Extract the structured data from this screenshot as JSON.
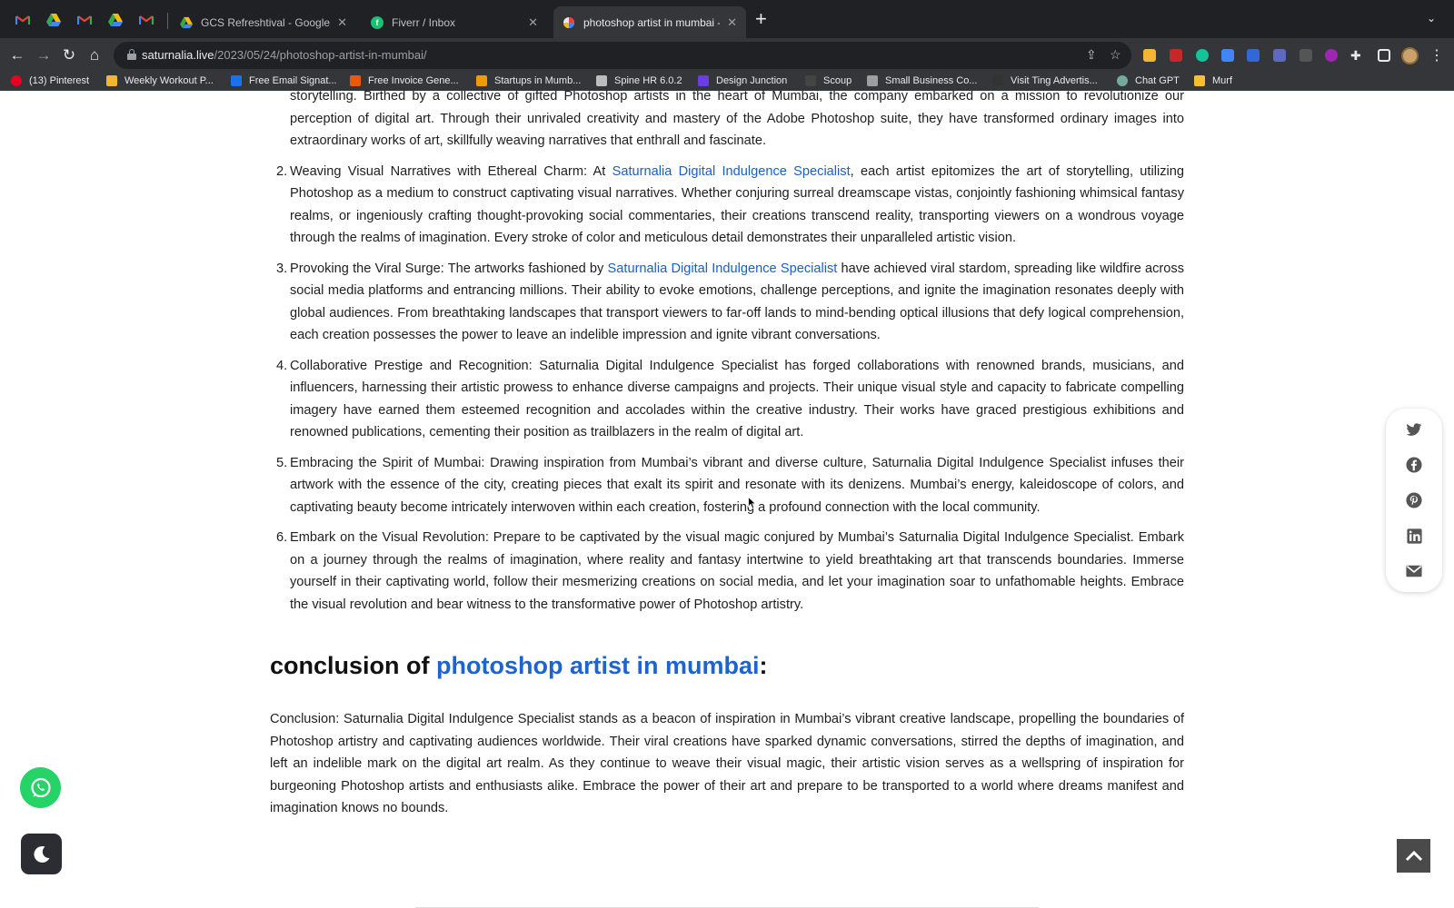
{
  "browser": {
    "tabs": [
      {
        "title": "GCS Refreshtival - Google Drive",
        "favicon": "google-drive"
      },
      {
        "title": "Fiverr / Inbox",
        "favicon": "fiverr"
      },
      {
        "title": "photoshop artist in mumbai - S",
        "favicon": "site",
        "active": true
      }
    ],
    "url_host": "saturnalia.live",
    "url_path": "/2023/05/24/photoshop-artist-in-mumbai/",
    "bookmarks": [
      {
        "label": "(13) Pinterest",
        "icon": "pinterest",
        "color": "#e60023"
      },
      {
        "label": "Weekly Workout P...",
        "icon": "doc",
        "color": "#f2b634"
      },
      {
        "label": "Free Email Signat...",
        "icon": "mail",
        "color": "#1a73e8"
      },
      {
        "label": "Free Invoice Gene...",
        "icon": "invoice",
        "color": "#e8590c"
      },
      {
        "label": "Startups in Mumb...",
        "icon": "startup",
        "color": "#f29900"
      },
      {
        "label": "Spine HR 6.0.2",
        "icon": "spine",
        "color": "#bdbdbd"
      },
      {
        "label": "Design Junction",
        "icon": "design",
        "color": "#6a3de8"
      },
      {
        "label": "Scoup",
        "icon": "scoup",
        "color": "#444444"
      },
      {
        "label": "Small Business Co...",
        "icon": "business",
        "color": "#9e9e9e"
      },
      {
        "label": "Visit Ting Advertis...",
        "icon": "ting",
        "color": "#333333"
      },
      {
        "label": "Chat GPT",
        "icon": "chatgpt",
        "color": "#74aa9c"
      },
      {
        "label": "Murf",
        "icon": "murf",
        "color": "#f6c026"
      }
    ]
  },
  "article": {
    "intro_tail": "storytelling. Birthed by a collective of gifted Photoshop artists in the heart of Mumbai, the company embarked on a mission to revolutionize our perception of digital art. Through their unrivaled creativity and mastery of the Adobe Photoshop suite, they have transformed ordinary images into extraordinary works of art, skillfully weaving narratives that enthrall and fascinate.",
    "items": [
      {
        "num": "2.",
        "before": "Weaving Visual Narratives with Ethereal Charm: At ",
        "link": "Saturnalia Digital Indulgence Specialist",
        "after": ", each artist epitomizes the art of storytelling, utilizing Photoshop as a medium to construct captivating visual narratives. Whether conjuring surreal dreamscape vistas, conjointly fashioning whimsical fantasy realms, or ingeniously crafting thought-provoking social commentaries, their creations transcend reality, transporting viewers on a wondrous voyage through the realms of imagination. Every stroke of color and meticulous detail demonstrates their unparalleled artistic vision."
      },
      {
        "num": "3.",
        "before": "Provoking the Viral Surge: The artworks fashioned by ",
        "link": "Saturnalia Digital Indulgence Specialist",
        "after": " have achieved viral stardom, spreading like wildfire across social media platforms and entrancing millions. Their ability to evoke emotions, challenge perceptions, and ignite the imagination resonates deeply with global audiences. From breathtaking landscapes that transport viewers to far-off lands to mind-bending optical illusions that defy logical comprehension, each creation possesses the power to leave an indelible impression and ignite vibrant conversations."
      },
      {
        "num": "4.",
        "text": "Collaborative Prestige and Recognition: Saturnalia Digital Indulgence Specialist has forged collaborations with renowned brands, musicians, and influencers, harnessing their artistic prowess to enhance diverse campaigns and projects. Their unique visual style and capacity to fabricate compelling imagery have earned them esteemed recognition and accolades within the creative industry. Their works have graced prestigious exhibitions and renowned publications, cementing their position as trailblazers in the realm of digital art."
      },
      {
        "num": "5.",
        "text": "Embracing the Spirit of Mumbai: Drawing inspiration from Mumbai’s vibrant and diverse culture, Saturnalia Digital Indulgence Specialist infuses their artwork with the essence of the city, creating pieces that exalt its spirit and resonate with its denizens. Mumbai’s energy, kaleidoscope of colors, and captivating beauty become intricately interwoven within each creation, fostering a profound connection with the local community."
      },
      {
        "num": "6.",
        "text": "Embark on the Visual Revolution: Prepare to be captivated by the visual magic conjured by Mumbai’s Saturnalia Digital Indulgence Specialist. Embark on a journey through the realms of imagination, where reality and fantasy intertwine to yield breathtaking art that transcends boundaries. Immerse yourself in their captivating world, follow their mesmerizing creations on social media, and let your imagination soar to unfathomable heights. Embrace the visual revolution and bear witness to the transformative power of Photoshop artistry."
      }
    ],
    "heading_prefix": "conclusion of ",
    "heading_link": "photoshop artist in mumbai",
    "heading_suffix": ":",
    "conclusion": "Conclusion: Saturnalia Digital Indulgence Specialist stands as a beacon of inspiration in Mumbai’s vibrant creative landscape, propelling the boundaries of Photoshop artistry and captivating audiences worldwide. Their viral creations have sparked dynamic conversations, stirred the depths of imagination, and left an indelible mark on the digital art realm. As they continue to weave their visual magic, their artistic vision serves as a wellspring of inspiration for burgeoning Photoshop artists and enthusiasts alike. Embrace the power of their art and prepare to be transported to a world where dreams manifest and imagination knows no bounds."
  },
  "share_icons": [
    "twitter-icon",
    "facebook-icon",
    "pinterest-icon",
    "linkedin-icon",
    "email-icon"
  ],
  "colors": {
    "link": "#1a5fc4",
    "whatsapp": "#25d366",
    "chrome_dark": "#202124",
    "chrome_toolbar": "#35363a"
  }
}
